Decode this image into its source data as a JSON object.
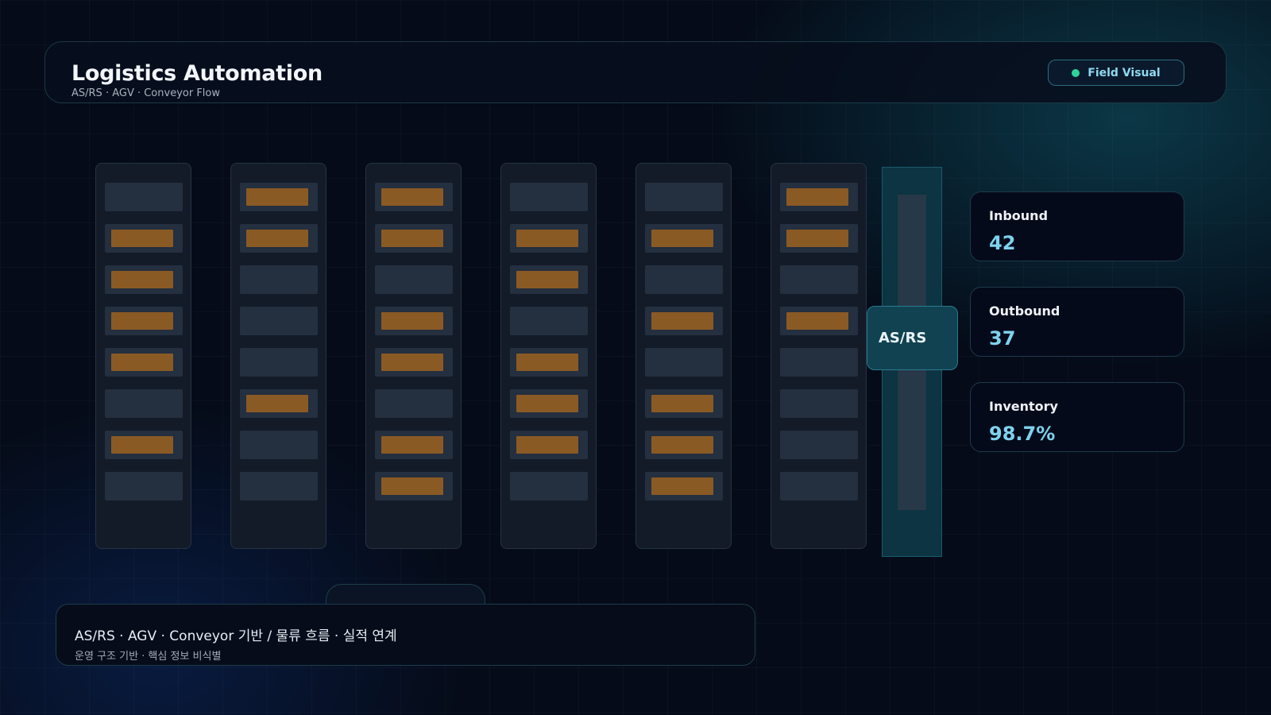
{
  "header": {
    "title": "Logistics Automation",
    "subtitle": "AS/RS · AGV · Conveyor Flow",
    "field_visual_label": "Field Visual",
    "status_color": "#2fd39a"
  },
  "racks": [
    {
      "slots": [
        0,
        1,
        1,
        1,
        1,
        0,
        1,
        0
      ]
    },
    {
      "slots": [
        1,
        1,
        0,
        0,
        0,
        1,
        0,
        0
      ]
    },
    {
      "slots": [
        1,
        1,
        0,
        1,
        1,
        0,
        1,
        1
      ]
    },
    {
      "slots": [
        0,
        1,
        1,
        0,
        1,
        1,
        1,
        0
      ]
    },
    {
      "slots": [
        0,
        1,
        0,
        1,
        0,
        1,
        1,
        1
      ]
    },
    {
      "slots": [
        1,
        1,
        0,
        1,
        0,
        0,
        0,
        0
      ]
    }
  ],
  "asrs": {
    "label": "AS/RS"
  },
  "stats": [
    {
      "label": "Inbound",
      "value": "42"
    },
    {
      "label": "Outbound",
      "value": "37"
    },
    {
      "label": "Inventory",
      "value": "98.7%"
    }
  ],
  "footer": {
    "main": "AS/RS · AGV · Conveyor 기반 / 물류 흐름 · 실적 연계",
    "sub": "운영 구조 기반 · 핵심 정보 비식별"
  },
  "colors": {
    "accent": "#7fd2ee",
    "filled_slot": "#8a5a24",
    "empty_slot": "#242f3f"
  }
}
